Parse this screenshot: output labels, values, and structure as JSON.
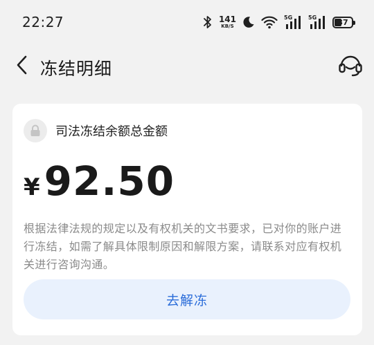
{
  "status_bar": {
    "time": "22:27",
    "net_speed_value": "141",
    "net_speed_unit": "KB/S",
    "sim1_tag": "5G",
    "sim2_tag": "5G",
    "battery": "37",
    "icons": [
      "bluetooth-icon",
      "moon-icon",
      "wifi-icon",
      "signal-icon",
      "signal-icon",
      "battery-icon"
    ]
  },
  "header": {
    "title": "冻结明细",
    "back_icon": "chevron-left-icon",
    "service_icon": "headset-icon"
  },
  "card": {
    "label": "司法冻结余额总金额",
    "currency_symbol": "¥",
    "amount": "92.50",
    "description": "根据法律法规的规定以及有权机关的文书要求，已对你的账户进行冻结，如需了解具体限制原因和解限方案，请联系对应有权机关进行咨询沟通。",
    "button_label": "去解冻"
  },
  "colors": {
    "background": "#f2f2f2",
    "card": "#ffffff",
    "button_bg": "#e9f1fd",
    "button_text": "#2a6cd9",
    "muted_text": "#8a8a8a"
  }
}
